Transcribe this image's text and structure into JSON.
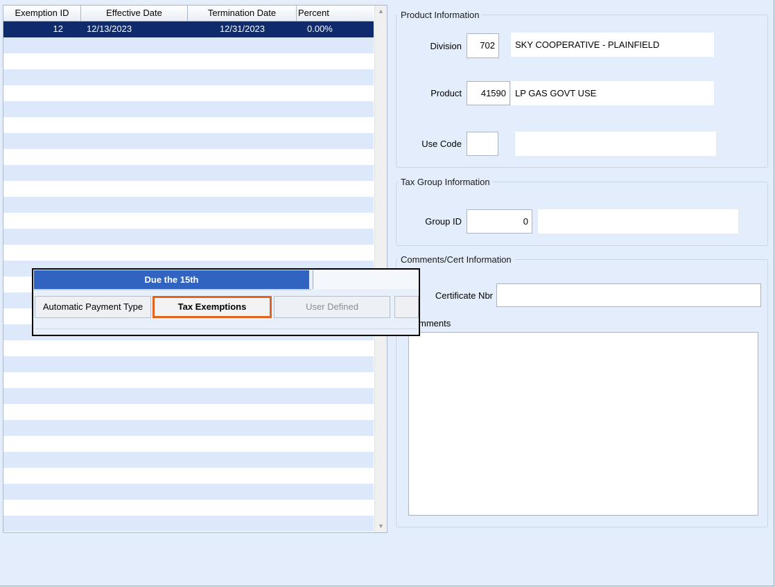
{
  "grid": {
    "columns": [
      "Exemption ID",
      "Effective Date",
      "Termination Date",
      "Percent"
    ],
    "rows": [
      {
        "id": "12",
        "effective": "12/13/2023",
        "termination": "12/31/2023",
        "percent": "0.00%"
      }
    ],
    "selected_row": 0
  },
  "product_info": {
    "legend": "Product Information",
    "division_label": "Division",
    "division_code": "702",
    "division_name": "SKY COOPERATIVE - PLAINFIELD",
    "product_label": "Product",
    "product_code": "41590",
    "product_name": "LP GAS GOVT USE",
    "use_code_label": "Use Code",
    "use_code": "",
    "use_code_desc": ""
  },
  "tax_group": {
    "legend": "Tax Group Information",
    "group_id_label": "Group ID",
    "group_id": "0",
    "group_desc": ""
  },
  "comments": {
    "legend": "Comments/Cert Information",
    "certificate_label": "Certificate Nbr",
    "certificate_value": "",
    "comments_label": "mments",
    "comments_value": ""
  },
  "popup": {
    "tab_label": "Due the 15th",
    "buttons": [
      {
        "label": "Automatic Payment Type",
        "state": "normal"
      },
      {
        "label": "Tax Exemptions",
        "state": "active"
      },
      {
        "label": "User Defined",
        "state": "disabled"
      },
      {
        "label": "",
        "state": "normal"
      }
    ]
  },
  "colors": {
    "selection": "#0f2b6e",
    "popup_tab": "#3163c0",
    "active_outline": "#e06420"
  }
}
